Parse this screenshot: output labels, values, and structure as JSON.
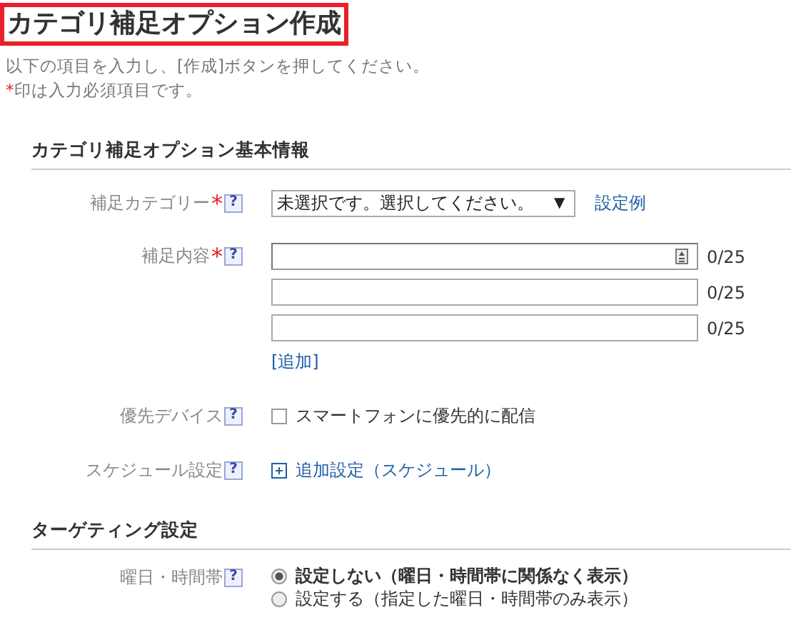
{
  "page_title": "カテゴリ補足オプション作成",
  "instructions": "以下の項目を入力し、[作成]ボタンを押してください。",
  "required_note": {
    "mark": "*",
    "text": "印は入力必須項目です。"
  },
  "sections": [
    {
      "title": "カテゴリ補足オプション基本情報",
      "rows": [
        {
          "kind": "select",
          "label": "補足カテゴリー",
          "required": true,
          "help": "?",
          "value": "未選択です。選択してください。",
          "arrow": "▼",
          "link": "設定例"
        },
        {
          "kind": "texts",
          "label": "補足内容",
          "required": true,
          "help": "?",
          "fields": [
            {
              "count": "0/25",
              "focused": true
            },
            {
              "count": "0/25",
              "focused": false
            },
            {
              "count": "0/25",
              "focused": false
            }
          ],
          "add_link": "[追加]"
        },
        {
          "kind": "checkbox",
          "label": "優先デバイス",
          "required": false,
          "help": "?",
          "option": "スマートフォンに優先的に配信",
          "checked": false
        },
        {
          "kind": "expand",
          "label": "スケジュール設定",
          "required": false,
          "help": "?",
          "link": "追加設定（スケジュール）"
        }
      ]
    },
    {
      "title": "ターゲティング設定",
      "rows": [
        {
          "kind": "radios",
          "label": "曜日・時間帯",
          "required": false,
          "help": "?",
          "options": [
            {
              "label": "設定しない（曜日・時間帯に関係なく表示）",
              "selected": true
            },
            {
              "label": "設定する（指定した曜日・時間帯のみ表示）",
              "selected": false
            }
          ]
        }
      ]
    }
  ]
}
